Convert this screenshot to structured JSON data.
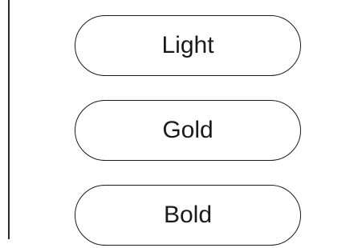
{
  "options": [
    {
      "label": "Light"
    },
    {
      "label": "Gold"
    },
    {
      "label": "Bold"
    }
  ]
}
